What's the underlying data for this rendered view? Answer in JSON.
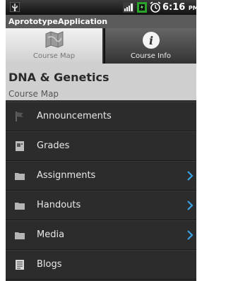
{
  "status_bar": {
    "icons": [
      "usb-icon",
      "signal-icon",
      "battery-icon",
      "alarm-icon"
    ],
    "time": "6:16",
    "ampm": "PM"
  },
  "app": {
    "title": "AprototypeApplication"
  },
  "tabs": [
    {
      "label": "Course Map",
      "icon": "map-icon",
      "selected": true
    },
    {
      "label": "Course Info",
      "icon": "info-icon",
      "selected": false
    }
  ],
  "course": {
    "title": "DNA & Genetics",
    "section": "Course Map"
  },
  "menu": [
    {
      "label": "Announcements",
      "icon": "flag-icon",
      "chevron": false
    },
    {
      "label": "Grades",
      "icon": "grades-icon",
      "chevron": false
    },
    {
      "label": "Assignments",
      "icon": "folder-icon",
      "chevron": true
    },
    {
      "label": "Handouts",
      "icon": "folder-icon",
      "chevron": true
    },
    {
      "label": "Media",
      "icon": "folder-icon",
      "chevron": true
    },
    {
      "label": "Blogs",
      "icon": "document-icon",
      "chevron": false
    }
  ],
  "colors": {
    "accent": "#3aa0e0",
    "header_bg": "#cfcfcf",
    "list_bg": "#2c2c2c"
  }
}
